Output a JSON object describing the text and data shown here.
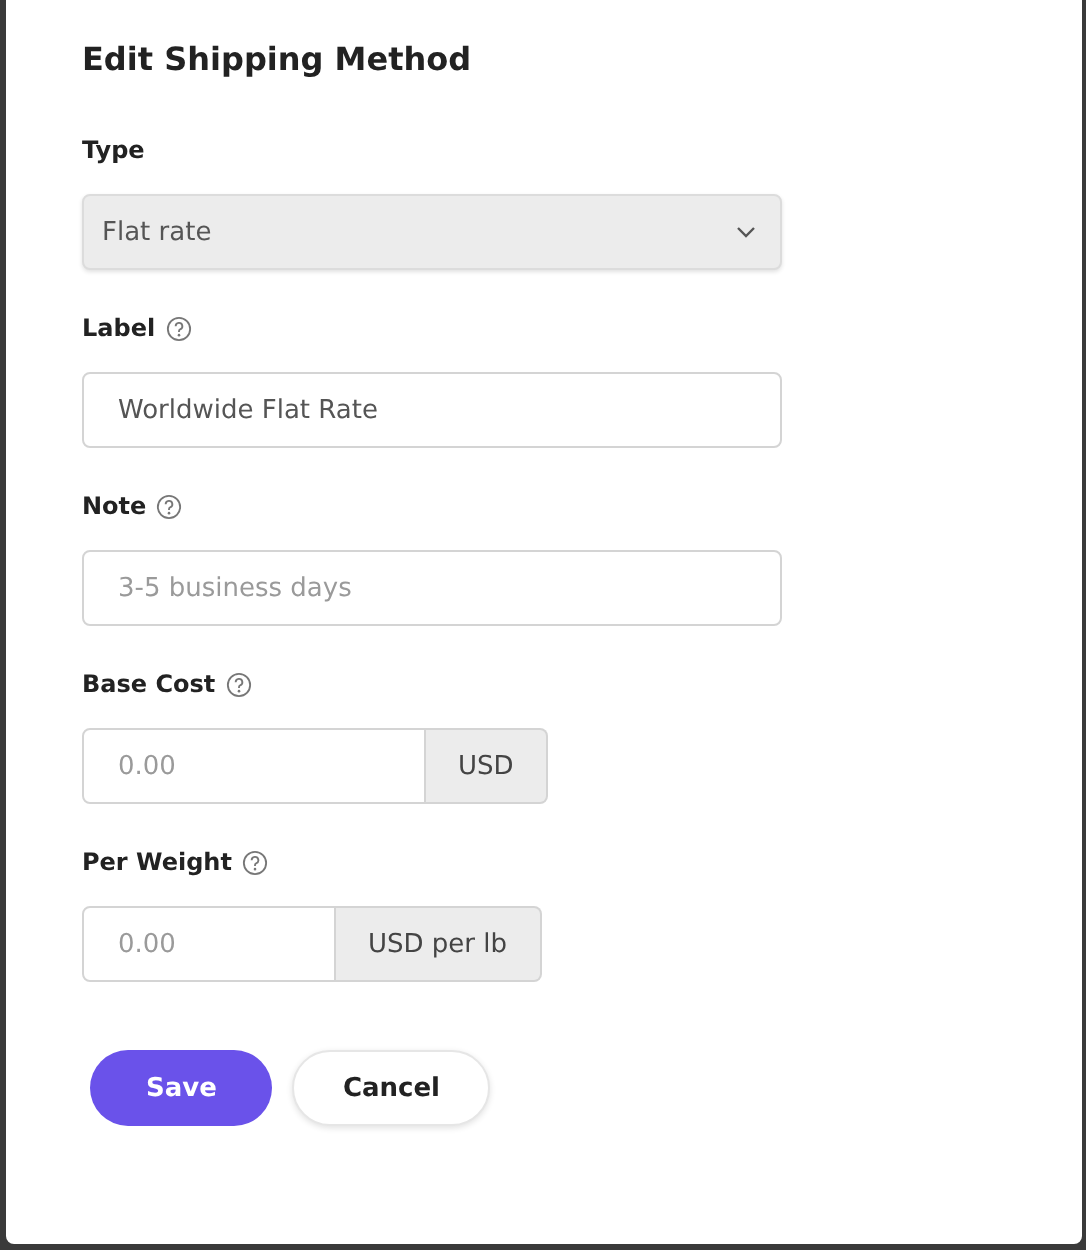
{
  "dialog": {
    "title": "Edit Shipping Method"
  },
  "fields": [
    {
      "kind": "select",
      "label": "Type",
      "help": false,
      "value": "Flat rate"
    },
    {
      "kind": "text",
      "label": "Label",
      "help": true,
      "value": "Worldwide Flat Rate"
    },
    {
      "kind": "text",
      "label": "Note",
      "help": true,
      "placeholder": "3-5 business days"
    },
    {
      "kind": "money",
      "label": "Base Cost",
      "help": true,
      "placeholder": "0.00",
      "unit": "USD"
    },
    {
      "kind": "money",
      "label": "Per Weight",
      "help": true,
      "placeholder": "0.00",
      "unit": "USD per lb"
    }
  ],
  "buttons": [
    {
      "label": "Save",
      "kind": "primary"
    },
    {
      "label": "Cancel",
      "kind": "secondary"
    }
  ]
}
